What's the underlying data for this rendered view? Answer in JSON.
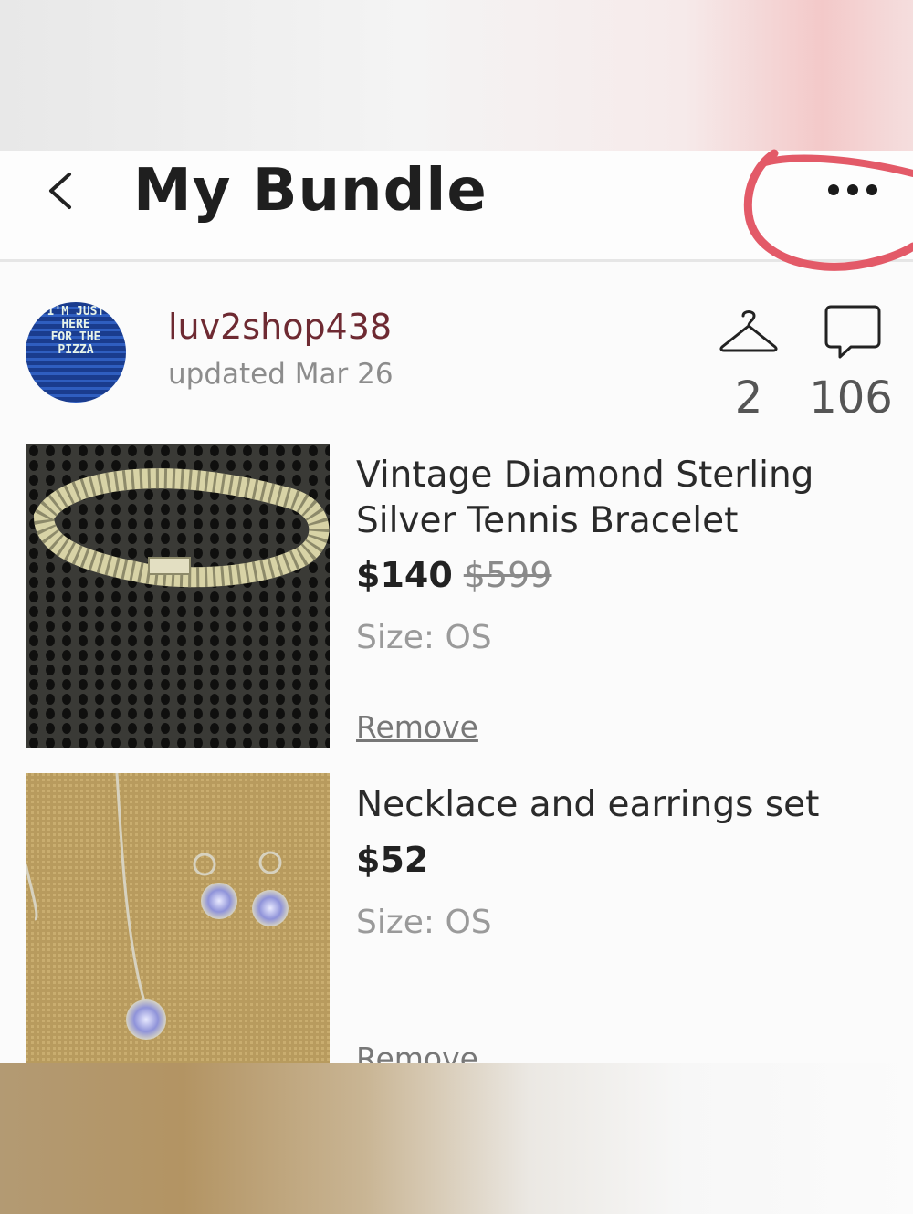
{
  "header": {
    "title": "My Bundle"
  },
  "seller": {
    "username": "luv2shop438",
    "updated": "updated Mar 26",
    "avatar_text": [
      "I'M JUST",
      "HERE",
      "FOR THE",
      "PIZZA"
    ]
  },
  "stats": {
    "likes": "2",
    "comments": "106"
  },
  "items": [
    {
      "title_line1": "Vintage Diamond Sterling",
      "title_line2": "Silver Tennis Bracelet",
      "price": "$140",
      "original_price": "$599",
      "size": "Size:  OS",
      "remove": "Remove"
    },
    {
      "title_line1": "Necklace and earrings set",
      "price": "$52",
      "size": "Size:  OS",
      "remove": "Remove"
    }
  ],
  "colors": {
    "username": "#6e2a32",
    "annotation_circle": "#e35a68"
  },
  "icons": {
    "back": "chevron-left-icon",
    "more": "more-horizontal-icon",
    "likes": "hanger-icon",
    "comments": "speech-bubble-icon"
  }
}
